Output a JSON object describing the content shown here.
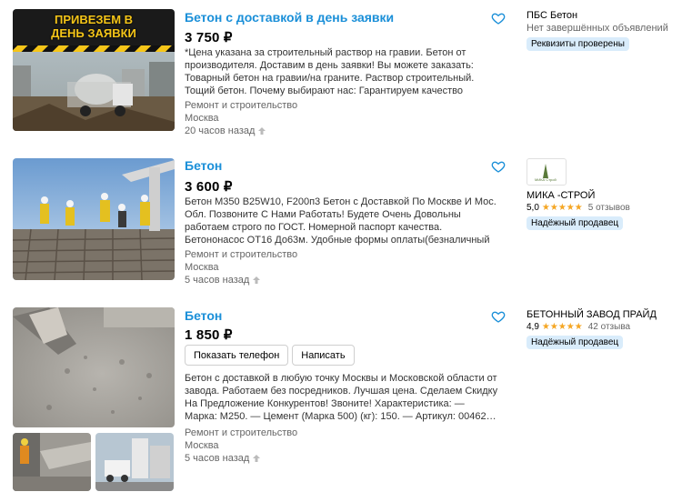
{
  "listings": [
    {
      "photo_banner": "ПРИВЕЗЕМ В ДЕНЬ ЗАЯВКИ",
      "title": "Бетон с доставкой в день заявки",
      "price": "3 750 ₽",
      "description": "*Цена указана за строительный раствор на гравии. Бетон от производителя. Доставим в день заявки! Вы можете заказать: Товарный бетон на гравии/на граните. Раствор строительный. Тощий бетон. Почему выбирают нас: Гарантируем качество бетона…",
      "category": "Ремонт и строительство",
      "location": "Москва",
      "time": "20 часов назад",
      "seller": {
        "name": "ПБС Бетон",
        "sub": "Нет завершённых объявлений",
        "badge": "Реквизиты проверены"
      }
    },
    {
      "title": "Бетон",
      "price": "3 600 ₽",
      "description": "Бетон М350 B25W10, F200п3 Бетон с Доставкой По Москве И Мос. Обл. Позвоните С Нами Работать! Будете Очень Довольны работаем строго по ГОСТ. Номерной паспорт качества. Бетононасос ОТ16 До63м. Удобные формы оплаты(безналичный расчёт юр…",
      "category": "Ремонт и строительство",
      "location": "Москва",
      "time": "5 часов назад",
      "seller": {
        "logo_text": "МИКА Строй",
        "name": "МИКА -СТРОЙ",
        "rating": "5,0",
        "stars": "★★★★★",
        "reviews": "5 отзывов",
        "badge": "Надёжный продавец"
      }
    },
    {
      "title": "Бетон",
      "price": "1 850 ₽",
      "show_phone": "Показать телефон",
      "write": "Написать",
      "description": "Бетон с доставкой в любую точку Москвы и Московской области от завода. Работаем без посредников. Лучшая цена. Сделаем Скидку На Предложение Конкурентов! Звоните! Характеристика: — Марка: М250. — Цемент (Марка 500) (кг): 150. — Артикул: 00462…",
      "category": "Ремонт и строительство",
      "location": "Москва",
      "time": "5 часов назад",
      "seller": {
        "name": "БЕТОННЫЙ ЗАВОД ПРАЙД",
        "rating": "4,9",
        "stars": "★★★★★",
        "reviews": "42 отзыва",
        "badge": "Надёжный продавец"
      }
    }
  ],
  "colors": {
    "title": "#1a8fd8",
    "badge_bg": "#d9ecfb",
    "star": "#f5a623",
    "banner_yellow": "#f5c518"
  },
  "icons": {
    "favorite": "heart-outline-icon",
    "raise": "up-arrow-icon",
    "rating": "star-icon"
  }
}
